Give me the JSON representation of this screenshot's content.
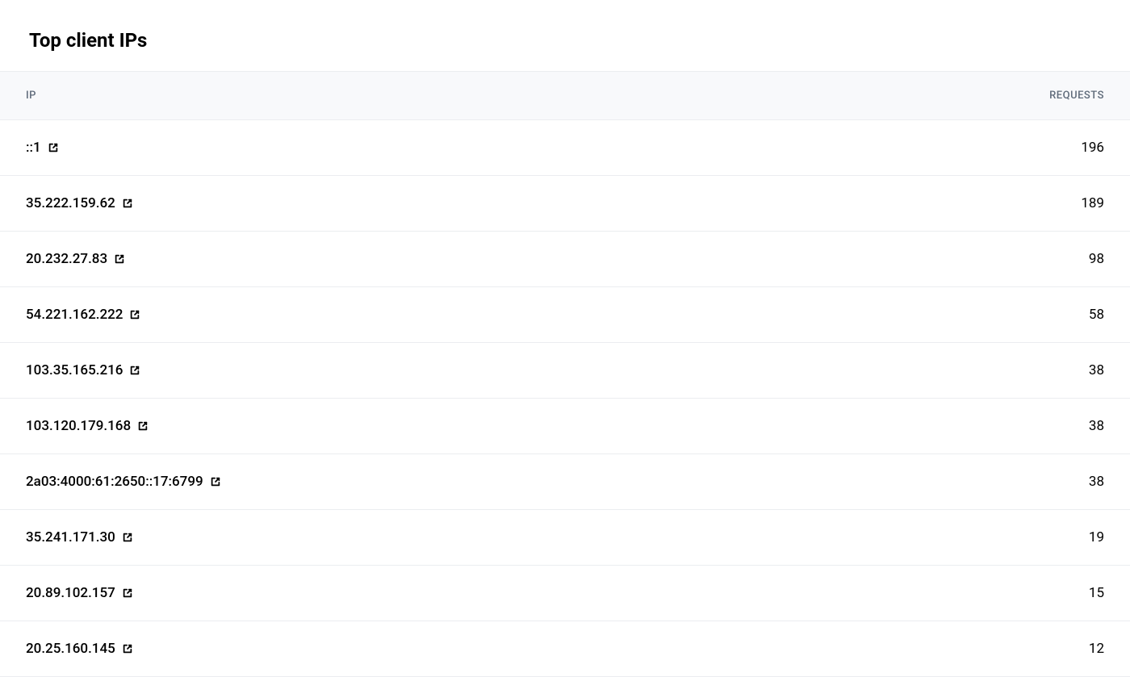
{
  "title": "Top client IPs",
  "columns": {
    "ip": "IP",
    "requests": "REQUESTS"
  },
  "rows": [
    {
      "ip": "::1",
      "requests": "196"
    },
    {
      "ip": "35.222.159.62",
      "requests": "189"
    },
    {
      "ip": "20.232.27.83",
      "requests": "98"
    },
    {
      "ip": "54.221.162.222",
      "requests": "58"
    },
    {
      "ip": "103.35.165.216",
      "requests": "38"
    },
    {
      "ip": "103.120.179.168",
      "requests": "38"
    },
    {
      "ip": "2a03:4000:61:2650::17:6799",
      "requests": "38"
    },
    {
      "ip": "35.241.171.30",
      "requests": "19"
    },
    {
      "ip": "20.89.102.157",
      "requests": "15"
    },
    {
      "ip": "20.25.160.145",
      "requests": "12"
    }
  ]
}
